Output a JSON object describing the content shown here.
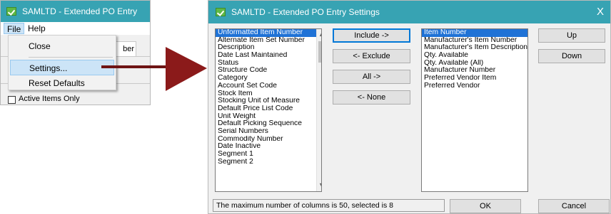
{
  "window1": {
    "title": "SAMLTD - Extended PO Entry",
    "menu": {
      "file": "File",
      "help": "Help"
    },
    "dropdown": {
      "close": "Close",
      "settings": "Settings...",
      "reset_defaults": "Reset Defaults"
    },
    "background_tab_fragment": "ber",
    "active_items_only_label": "Active Items Only",
    "active_items_only_checked": false
  },
  "dialog": {
    "title": "SAMLTD - Extended PO Entry Settings",
    "close_glyph": "X",
    "available_columns": [
      "Unformatted Item Number",
      "Alternate Item Set Number",
      "Description",
      "Date Last Maintained",
      "Status",
      "Structure Code",
      "Category",
      "Account Set Code",
      "Stock Item",
      "Stocking Unit of Measure",
      "Default Price List Code",
      "Unit Weight",
      "Default Picking Sequence",
      "Serial Numbers",
      "Commodity Number",
      "Date Inactive",
      "Segment 1",
      "Segment 2"
    ],
    "available_selected_index": 0,
    "selected_columns": [
      "Item Number",
      "Manufacturer's Item Number",
      "Manufacturer's Item Description",
      "Qty. Available",
      "Qty. Available (All)",
      "Manufacturer Number",
      "Preferred Vendor Item",
      "Preferred Vendor"
    ],
    "selected_selected_index": 0,
    "buttons": {
      "include": "Include ->",
      "exclude": "<- Exclude",
      "all": "All ->",
      "none": "<- None",
      "up": "Up",
      "down": "Down",
      "ok": "OK",
      "cancel": "Cancel"
    },
    "status": "The maximum number of columns is 50, selected is 8"
  },
  "colors": {
    "titlebar": "#37a3b3",
    "menu_highlight": "#cce4f7",
    "list_selection": "#1f72d6",
    "arrow": "#8b1a1a"
  },
  "icons": {
    "app_icon": "green-checkmark-icon",
    "pointer": "red-arrow-icon"
  }
}
